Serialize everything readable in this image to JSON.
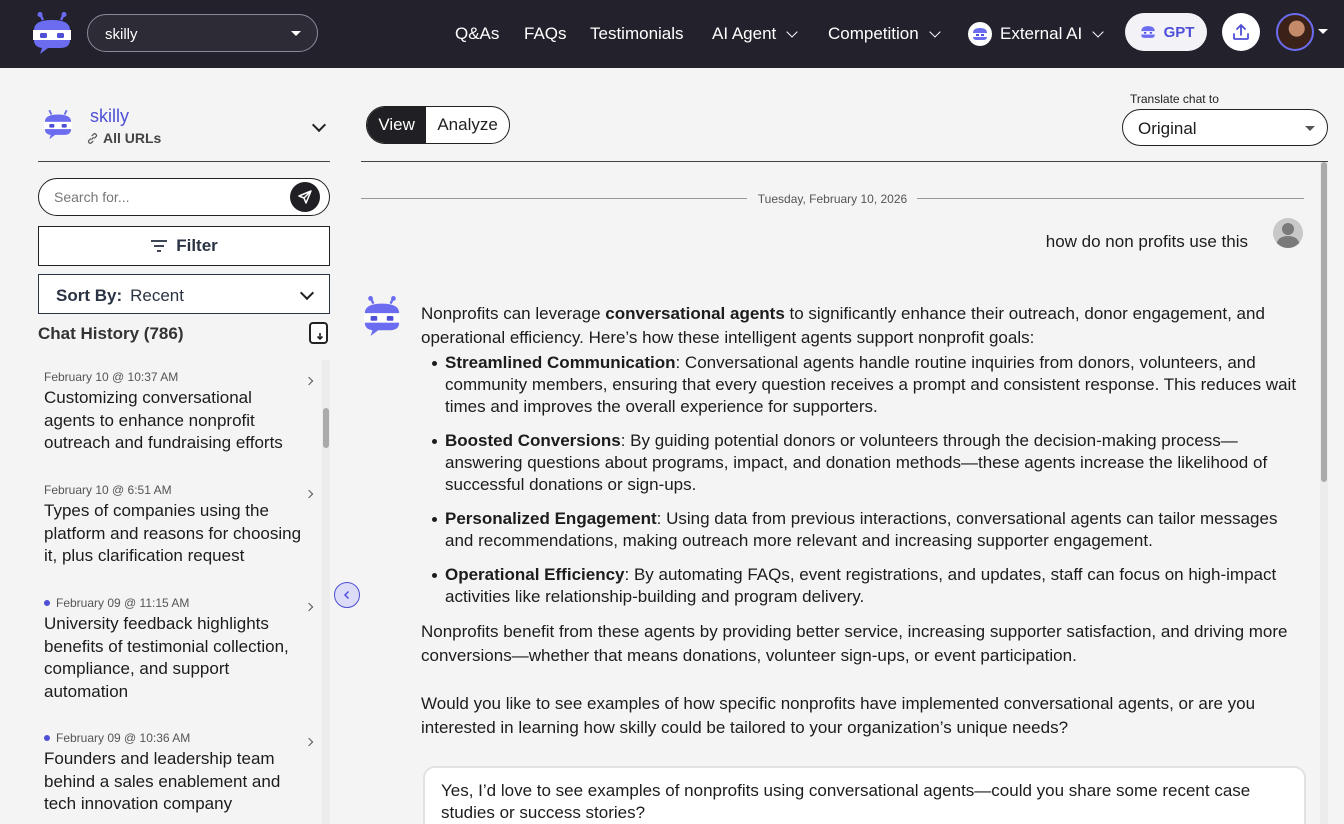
{
  "topbar": {
    "bot_selector": "skilly",
    "nav": [
      "Q&As",
      "FAQs",
      "Testimonials",
      "AI Agent",
      "Competition",
      "External AI"
    ],
    "gpt_label": "GPT"
  },
  "sidebar": {
    "bot_name": "skilly",
    "bot_scope": "All URLs",
    "search_placeholder": "Search for...",
    "filter_label": "Filter",
    "sort_label": "Sort By:",
    "sort_value": "Recent",
    "history_title": "Chat History (786)",
    "history": [
      {
        "date": "February 10 @ 10:37 AM",
        "title": "Customizing conversational agents to enhance nonprofit outreach and fundraising efforts",
        "unread": false
      },
      {
        "date": "February 10 @ 6:51 AM",
        "title": "Types of companies using the platform and reasons for choosing it, plus clarification request",
        "unread": false
      },
      {
        "date": "February 09 @ 11:15 AM",
        "title": "University feedback highlights benefits of testimonial collection, compliance, and support automation",
        "unread": true
      },
      {
        "date": "February 09 @ 10:36 AM",
        "title": "Founders and leadership team behind a sales enablement and tech innovation company",
        "unread": true
      }
    ]
  },
  "main": {
    "view_tabs": [
      "View",
      "Analyze"
    ],
    "translate_label": "Translate chat to",
    "translate_value": "Original",
    "date_separator": "Tuesday, February 10, 2026",
    "user_message": "how do non profits use this",
    "bot_intro_pre": "Nonprofits can leverage ",
    "bot_intro_bold": "conversational agents",
    "bot_intro_post": " to significantly enhance their outreach, donor engagement, and operational efficiency. Here’s how these intelligent agents support nonprofit goals:",
    "bullets": [
      {
        "title": "Streamlined Communication",
        "text": ": Conversational agents handle routine inquiries from donors, volunteers, and community members, ensuring that every question receives a prompt and consistent response. This reduces wait times and improves the overall experience for supporters."
      },
      {
        "title": "Boosted Conversions",
        "text": ": By guiding potential donors or volunteers through the decision-making process—answering questions about programs, impact, and donation methods—these agents increase the likelihood of successful donations or sign-ups."
      },
      {
        "title": "Personalized Engagement",
        "text": ": Using data from previous interactions, conversational agents can tailor messages and recommendations, making outreach more relevant and increasing supporter engagement."
      },
      {
        "title": "Operational Efficiency",
        "text": ": By automating FAQs, event registrations, and updates, staff can focus on high-impact activities like relationship-building and program delivery."
      }
    ],
    "bot_summary": "Nonprofits benefit from these agents by providing better service, increasing supporter satisfaction, and driving more conversions—whether that means donations, volunteer sign-ups, or event participation.",
    "bot_question": "Would you like to see examples of how specific nonprofits have implemented conversational agents, or are you interested in learning how skilly could be tailored to your organization’s unique needs?",
    "suggestion": "Yes, I’d love to see examples of nonprofits using conversational agents—could you share some recent case studies or success stories?"
  },
  "colors": {
    "accent": "#4e4fd6",
    "topbar": "#22212c"
  }
}
